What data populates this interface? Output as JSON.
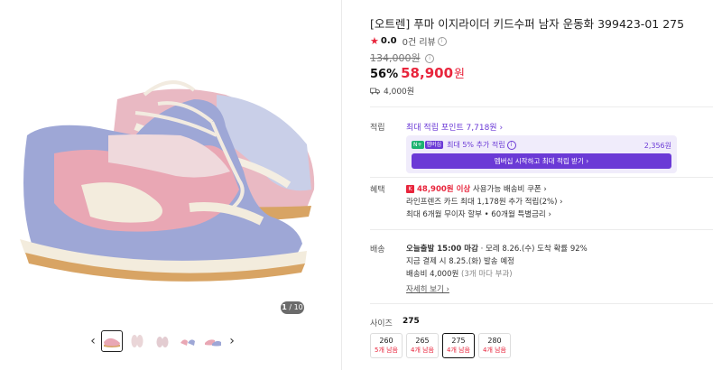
{
  "gallery": {
    "counter_current": "1",
    "counter_total": "/ 10",
    "prev_icon": "chevron-left-icon",
    "next_icon": "chevron-right-icon",
    "thumbnails": [
      {
        "view": "side"
      },
      {
        "view": "top"
      },
      {
        "view": "top-pair"
      },
      {
        "view": "pair"
      },
      {
        "view": "side-pair"
      }
    ]
  },
  "product": {
    "title": "[오트렌] 푸마 이지라이더 키드수퍼 남자 운동화 399423-01 275",
    "rating_score": "0.0",
    "review_count": "0건 리뷰",
    "original_price": "134,000원",
    "discount_pct": "56%",
    "sale_price": "58,900",
    "currency": "원",
    "shipping_fee": "4,000원"
  },
  "points": {
    "label": "적립",
    "max_accum": "최대 적립 포인트 7,718원 ›",
    "member_badge_1": "N+",
    "member_badge_2": "멤버십",
    "member_extra": "최대 5% 추가 적립",
    "member_amount": "2,356원",
    "member_cta": "멤버십 시작하고 최대 적립 받기 ›"
  },
  "benefits": {
    "label": "혜택",
    "coupon_amount": "48,900원 이상",
    "coupon_rest": " 사용가능 배송비 쿠폰 ›",
    "card_line": "라인프렌즈 카드 최대 1,178원 추가 적립(2%) ›",
    "installment_line": "최대 6개월 무이자 할부 • 60개월 특별금리 ›"
  },
  "delivery": {
    "label": "배송",
    "deadline_bold": "오늘출발 15:00 마감",
    "deadline_rest": " · 모레 8.26.(수) 도착 확률 92%",
    "dispatch_line": "지금 결제 시 8.25.(화) 발송 예정",
    "fee_line": "배송비 4,000원",
    "fee_note": " (3개 마다 부과)",
    "details_link": "자세히 보기 ›"
  },
  "size": {
    "label": "사이즈",
    "selected": "275",
    "options": [
      {
        "size": "260",
        "stock": "5개 남음"
      },
      {
        "size": "265",
        "stock": "4개 남음"
      },
      {
        "size": "275",
        "stock": "4개 남음"
      },
      {
        "size": "280",
        "stock": "4개 남음"
      }
    ]
  },
  "colors": {
    "accent_red": "#e8253c",
    "membership_purple": "#6b3ad6",
    "naver_green": "#1db370"
  }
}
